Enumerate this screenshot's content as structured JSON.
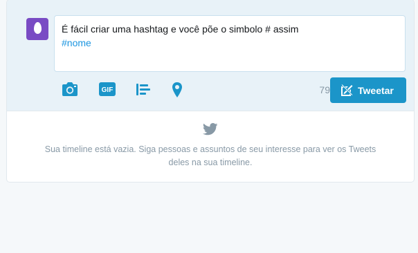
{
  "composer": {
    "text_line1": "É fácil criar uma hashtag e você põe o simbolo # assim",
    "hashtag": "#nome",
    "char_counter": "79",
    "tools": [
      {
        "icon": "camera-icon"
      },
      {
        "icon": "gif-icon",
        "label": "GIF"
      },
      {
        "icon": "poll-icon"
      },
      {
        "icon": "location-pin-icon"
      }
    ],
    "tweet_button": {
      "label": "Tweetar",
      "icon": "compose-icon"
    }
  },
  "timeline": {
    "empty_icon": "twitter-bird-icon",
    "empty_message": "Sua timeline está vazia. Siga pessoas e assuntos de seu interesse para ver os Tweets deles na sua timeline."
  },
  "colors": {
    "accent": "#1b95e0",
    "button": "#1b95c9",
    "avatar": "#794bc4",
    "composer_bg": "#e8f2f8",
    "muted_text": "#8899a6",
    "page_bg": "#f5f8fa"
  }
}
